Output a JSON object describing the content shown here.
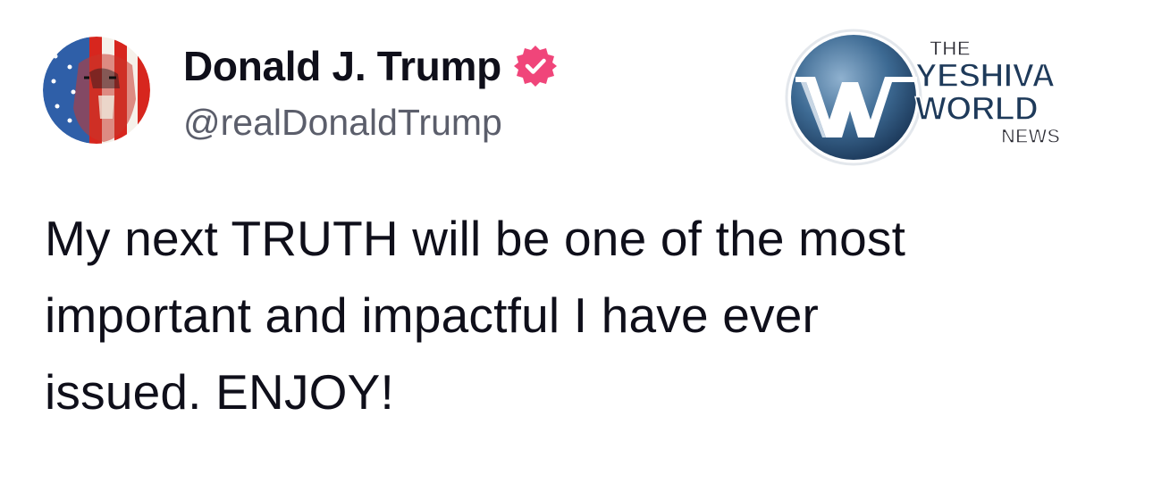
{
  "author": {
    "display_name": "Donald J. Trump",
    "handle": "@realDonaldTrump",
    "verified": true
  },
  "publisher": {
    "logo_line1": "THE",
    "logo_line2": "YESHIVA",
    "logo_line3": "WORLD",
    "logo_line4": "NEWS"
  },
  "post": {
    "lines": [
      "My next TRUTH will be one of the most",
      "important and impactful I have ever",
      "issued. ENJOY!"
    ]
  },
  "icons": {
    "avatar": "flag-portrait-avatar",
    "verified": "verified-badge-icon",
    "publisher": "ywn-logo-icon"
  },
  "colors": {
    "verified_badge": "#f0457a",
    "handle": "#5b5e6b",
    "text": "#0f0f1a",
    "logo_blue": "#1e3a5a"
  }
}
